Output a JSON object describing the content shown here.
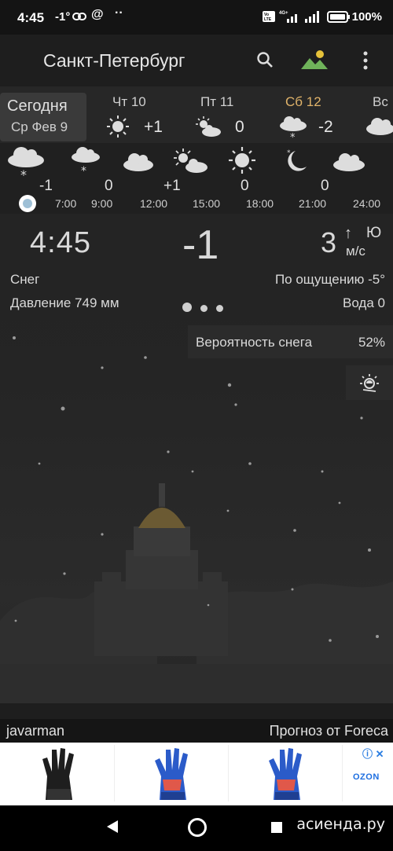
{
  "status_bar": {
    "time": "4:45",
    "temp": "-1°",
    "battery": "100%",
    "icons": [
      "link-icon",
      "at-icon",
      "more-dots-icon",
      "volte-icon",
      "signal-4g-icon",
      "signal-icon",
      "battery-icon"
    ]
  },
  "app_bar": {
    "city": "Санкт-Петербург",
    "icons": [
      "search-icon",
      "landscape-icon",
      "more-vert-icon"
    ]
  },
  "days": {
    "today_label": "Сегодня",
    "today_date": "Ср Фев 9",
    "items": [
      {
        "name": "Чт 10",
        "temp": "+1",
        "icon": "sun-icon"
      },
      {
        "name": "Пт 11",
        "temp": "0",
        "icon": "sun-cloud-icon"
      },
      {
        "name": "Сб 12",
        "temp": "-2",
        "icon": "snow-cloud-icon",
        "color": "#e0b36a"
      },
      {
        "name": "Вс",
        "temp": "",
        "icon": "cloud-icon"
      }
    ]
  },
  "hourly": {
    "items": [
      {
        "value": "-1",
        "time": "",
        "icon": "snow-cloud-icon"
      },
      {
        "value": "0",
        "time": "7:00",
        "icon": "snow-cloud-icon"
      },
      {
        "value": "+1",
        "time": "9:00",
        "icon": "cloud-icon"
      },
      {
        "value": "0",
        "time": "12:00",
        "icon": "sun-cloud-icon"
      },
      {
        "value": "0",
        "time": "15:00",
        "icon": "sun-icon"
      },
      {
        "value": "",
        "time": "18:00",
        "icon": "moon-icon"
      },
      {
        "value": "",
        "time": "21:00",
        "icon": "cloud-icon"
      },
      {
        "value": "",
        "time": "24:00",
        "icon": ""
      }
    ]
  },
  "current": {
    "time": "4:45",
    "temp": "-1",
    "wind_speed": "3",
    "wind_dir": "Ю",
    "wind_unit": "м/с",
    "condition": "Снег",
    "feels_like": "По ощущению -5°",
    "pressure": "Давление 749 мм",
    "water": "Вода 0",
    "page_count": 3,
    "active_page": 1
  },
  "precip": {
    "label": "Вероятность снега",
    "value": "52%"
  },
  "footer": {
    "user": "javarman",
    "source": "Прогноз от Foreca"
  },
  "ad": {
    "badge": "ⓘ ✕",
    "brand": "OZON",
    "items": [
      "black-goalkeeper-glove",
      "blue-goalkeeper-glove",
      "blue-goalkeeper-glove"
    ]
  },
  "watermark": "асиенда.ру"
}
